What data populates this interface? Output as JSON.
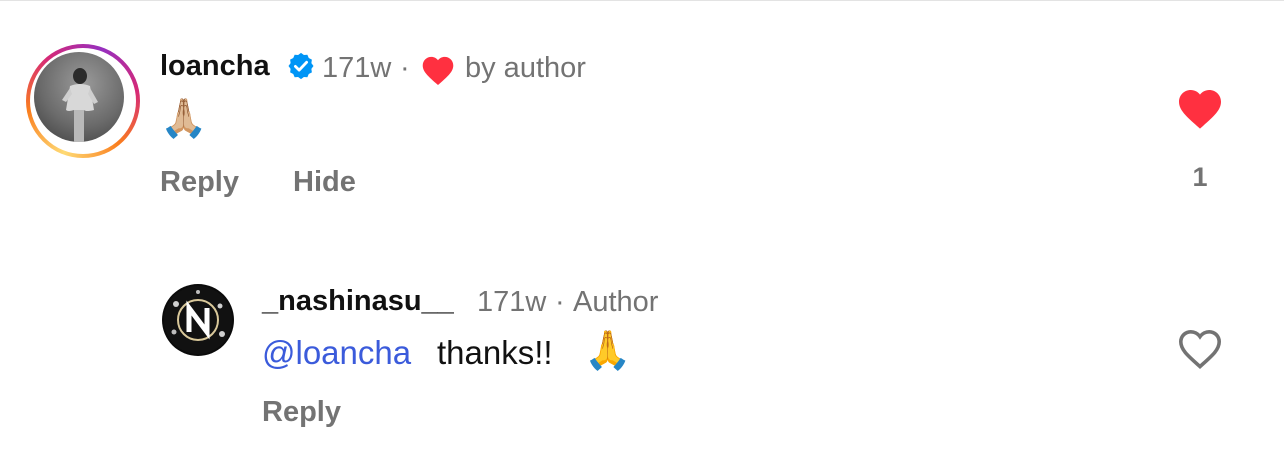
{
  "comments": [
    {
      "username": "loancha",
      "verified": true,
      "age": "171w",
      "separator": "·",
      "liked_by_author_label": "by author",
      "text": "🙏🏼",
      "actions": {
        "reply": "Reply",
        "hide": "Hide"
      },
      "like": {
        "liked": true,
        "count": "1"
      }
    },
    {
      "username": "_nashinasu__",
      "age": "171w",
      "separator": "·",
      "role_label": "Author",
      "mention": "@loancha",
      "text": "thanks!!",
      "emoji": "🙏",
      "actions": {
        "reply": "Reply"
      },
      "like": {
        "liked": false
      }
    }
  ],
  "colors": {
    "heart_red": "#ff3040",
    "verified_blue": "#0095f6",
    "mention_blue": "#3b5bdb",
    "muted_gray": "#737373"
  },
  "icons": {
    "verified": "verified-badge-icon",
    "liked_by_author": "heart-filled-icon",
    "like_filled": "heart-filled-icon",
    "like_outline": "heart-outline-icon",
    "avatar_ring": "story-ring"
  }
}
